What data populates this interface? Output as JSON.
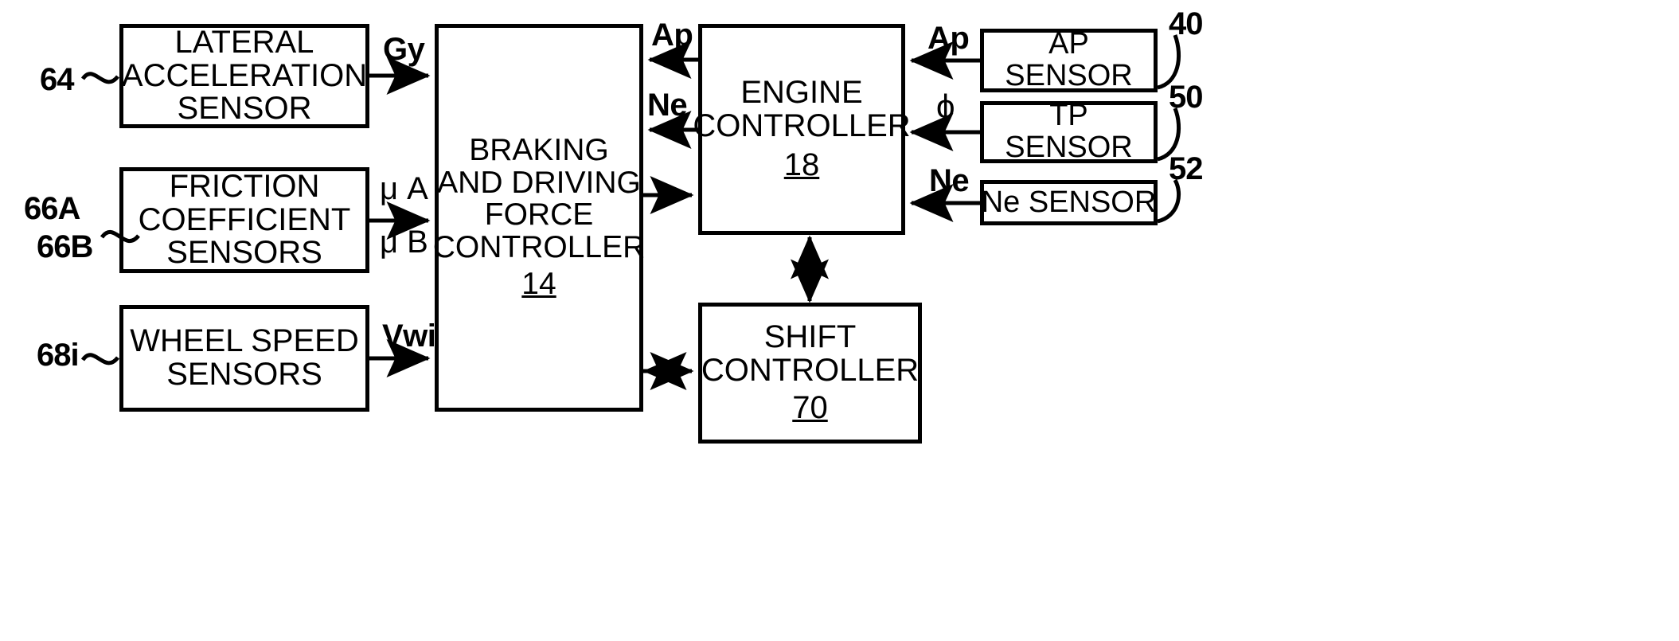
{
  "figure": {
    "type": "patent-block-diagram",
    "background": "#ffffff",
    "stroke": "#000000"
  },
  "blocks": {
    "lateral_acceleration_sensor": {
      "lines": [
        "LATERAL",
        "ACCELERATION",
        "SENSOR"
      ],
      "ref": "64"
    },
    "friction_coefficient_sensors": {
      "lines": [
        "FRICTION",
        "COEFFICIENT",
        "SENSORS"
      ],
      "ref_a": "66A",
      "ref_b": "66B"
    },
    "wheel_speed_sensors": {
      "lines": [
        "WHEEL SPEED",
        "SENSORS"
      ],
      "ref": "68i"
    },
    "braking_driving_force_controller": {
      "lines": [
        "BRAKING",
        "AND DRIVING",
        "FORCE",
        "CONTROLLER"
      ],
      "ref": "14"
    },
    "engine_controller": {
      "lines": [
        "ENGINE",
        "CONTROLLER"
      ],
      "ref": "18"
    },
    "shift_controller": {
      "lines": [
        "SHIFT",
        "CONTROLLER"
      ],
      "ref": "70"
    },
    "ap_sensor": {
      "lines": [
        "AP",
        "SENSOR"
      ],
      "ref": "40"
    },
    "tp_sensor": {
      "lines": [
        "TP",
        "SENSOR"
      ],
      "ref": "50"
    },
    "ne_sensor": {
      "lines": [
        "Ne SENSOR"
      ],
      "ref": "52"
    }
  },
  "signals": {
    "gy": "Gy",
    "mu_a": "μ A",
    "mu_b": "μ B",
    "vwi": "Vwi",
    "ap_left": "Ap",
    "ne_left": "Ne",
    "ap_right": "Ap",
    "phi": "ϕ",
    "ne_right": "Ne"
  }
}
